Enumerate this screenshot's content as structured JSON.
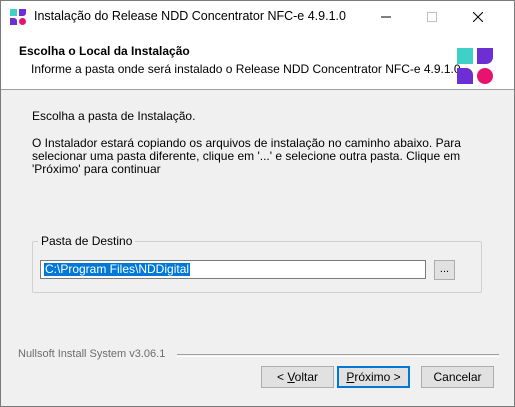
{
  "window": {
    "title": "Instalação do Release NDD Concentrator NFC-e 4.9.1.0",
    "controls": {
      "minimize_icon": "minimize-icon",
      "maximize_icon": "maximize-icon",
      "close_icon": "close-icon"
    }
  },
  "header": {
    "title": "Escolha o Local da Instalação",
    "subtitle": "Informe a pasta onde será instalado o Release NDD Concentrator NFC-e 4.9.1.0.",
    "logo_colors": [
      "#3fd1c7",
      "#6b2fd3",
      "#6b2fd3",
      "#e8136f"
    ]
  },
  "body": {
    "line1": "Escolha a pasta de Instalação.",
    "line2": "O Instalador estará copiando os arquivos de instalação no caminho abaixo. Para selecionar uma pasta diferente, clique em '...' e selecione outra pasta. Clique em 'Próximo' para continuar"
  },
  "destination": {
    "group_label": "Pasta de Destino",
    "path_value": "C:\\Program Files\\NDDigital",
    "browse_label": "..."
  },
  "footer": {
    "branding": "Nullsoft Install System v3.06.1",
    "back_prefix": "< ",
    "back_hotkey": "V",
    "back_rest": "oltar",
    "next_hotkey": "P",
    "next_rest": "róximo >",
    "cancel_label": "Cancelar"
  }
}
